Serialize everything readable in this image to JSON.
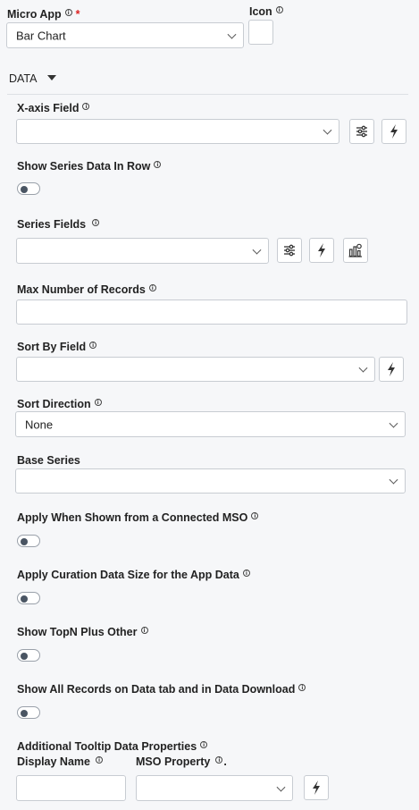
{
  "microapp": {
    "label": "Micro App",
    "required_mark": "*",
    "value": "Bar Chart"
  },
  "icon": {
    "label": "Icon"
  },
  "data_section": {
    "title": "DATA"
  },
  "xaxis": {
    "label": "X-axis Field",
    "value": ""
  },
  "show_series_row": {
    "label": "Show Series Data In Row",
    "on": false
  },
  "series_fields": {
    "label": "Series Fields",
    "value": ""
  },
  "max_records": {
    "label": "Max Number of Records",
    "value": ""
  },
  "sort_by": {
    "label": "Sort By Field",
    "value": ""
  },
  "sort_direction": {
    "label": "Sort Direction",
    "value": "None"
  },
  "base_series": {
    "label": "Base Series",
    "value": ""
  },
  "apply_mso": {
    "label": "Apply When Shown from a Connected MSO",
    "on": false
  },
  "apply_curation": {
    "label": "Apply Curation Data Size for the App Data",
    "on": false
  },
  "topn": {
    "label": "Show TopN Plus Other",
    "on": false
  },
  "show_all": {
    "label": "Show All Records on Data tab and in Data Download",
    "on": false
  },
  "tooltip": {
    "label": "Additional Tooltip Data Properties",
    "display_name_label": "Display Name",
    "mso_property_label": "MSO Property",
    "trailing_dot": ".",
    "display_name_value": "",
    "mso_property_value": ""
  },
  "info_glyph": "i",
  "icons": [
    "info-icon",
    "chevron-down-icon",
    "caret-down-icon",
    "sliders-icon",
    "bolt-icon",
    "chart-settings-icon"
  ]
}
